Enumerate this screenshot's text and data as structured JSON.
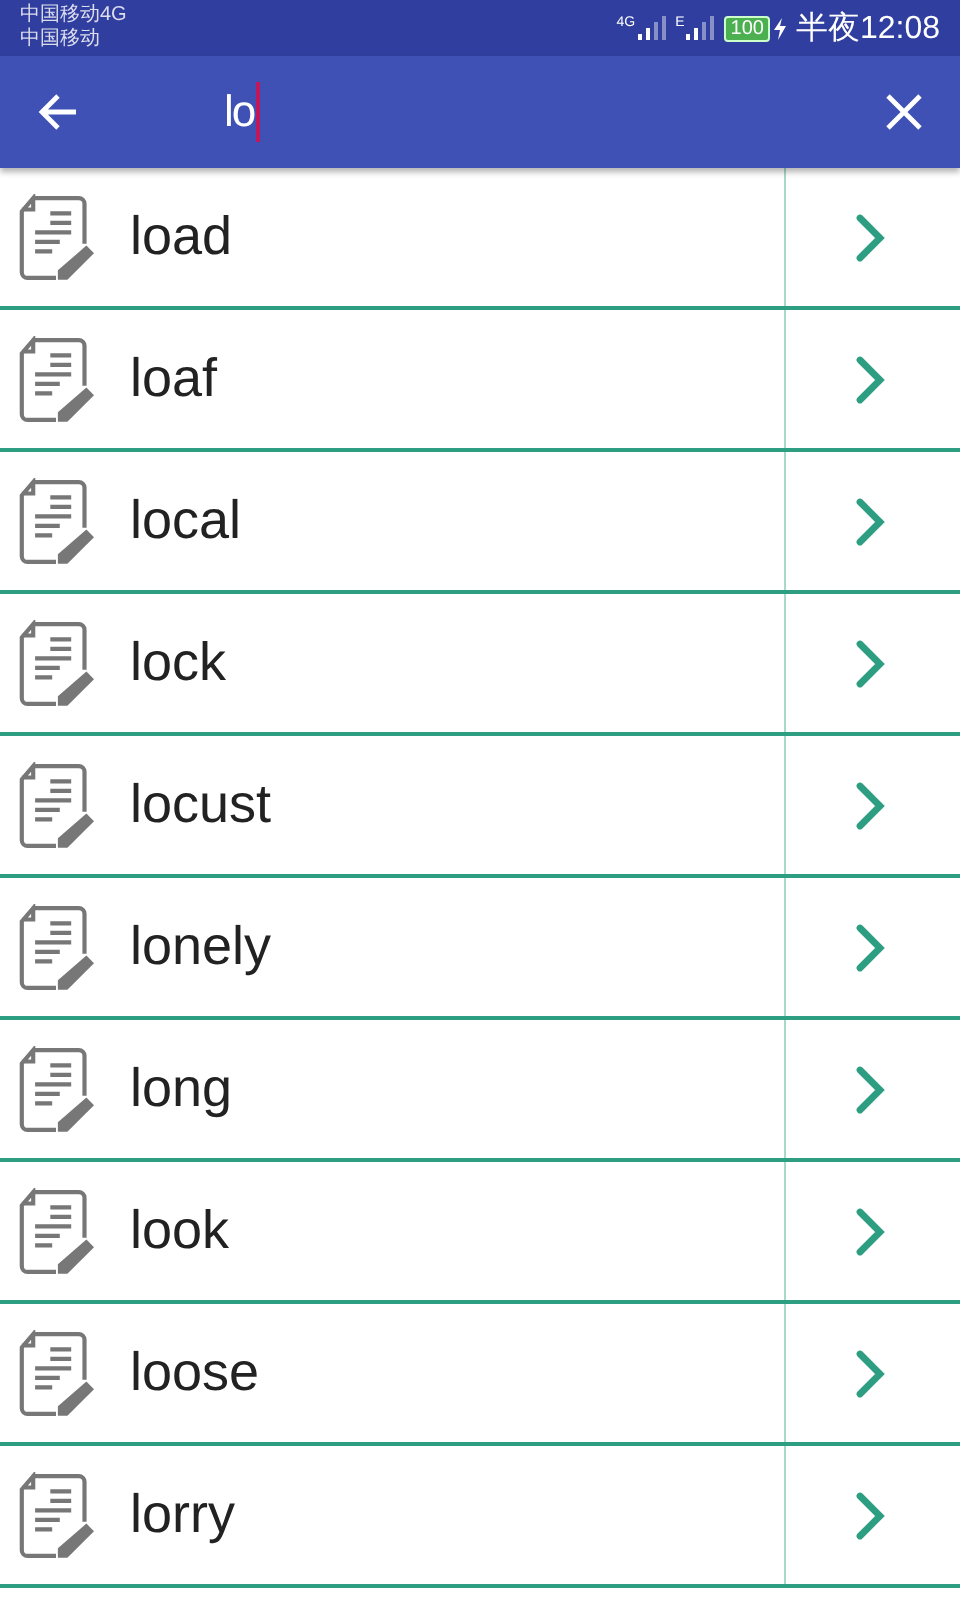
{
  "status_bar": {
    "carriers": [
      "中国移动4G",
      "中国移动"
    ],
    "network_1": "4G",
    "network_2": "E",
    "battery": "100",
    "time": "半夜12:08"
  },
  "search": {
    "value": "lo"
  },
  "results": [
    {
      "word": "load"
    },
    {
      "word": "loaf"
    },
    {
      "word": "local"
    },
    {
      "word": "lock"
    },
    {
      "word": "locust"
    },
    {
      "word": "lonely"
    },
    {
      "word": "long"
    },
    {
      "word": "look"
    },
    {
      "word": "loose"
    },
    {
      "word": "lorry"
    }
  ]
}
